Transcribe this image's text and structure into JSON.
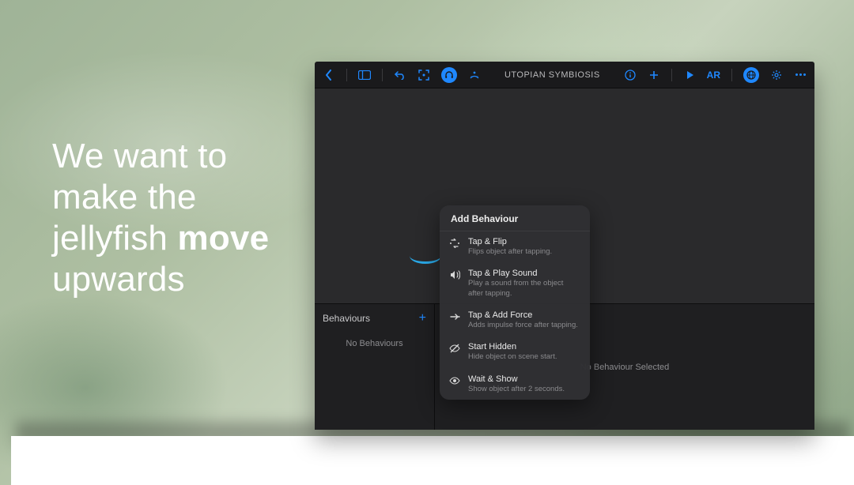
{
  "caption": {
    "line1": "We want to",
    "line2": "make the",
    "line3a": "jellyfish ",
    "line3b": "move",
    "line4": "upwards"
  },
  "toolbar": {
    "title": "UTOPIAN SYMBIOSIS",
    "ar_label": "AR"
  },
  "panel": {
    "behaviours_label": "Behaviours",
    "no_behaviours": "No Behaviours",
    "no_selection": "No Behaviour Selected"
  },
  "popup": {
    "title": "Add Behaviour",
    "items": [
      {
        "icon": "flip-icon",
        "title": "Tap & Flip",
        "desc": "Flips object after tapping."
      },
      {
        "icon": "sound-icon",
        "title": "Tap & Play Sound",
        "desc": "Play a sound from the object after tapping."
      },
      {
        "icon": "force-icon",
        "title": "Tap & Add Force",
        "desc": "Adds impulse force after tapping."
      },
      {
        "icon": "hidden-icon",
        "title": "Start Hidden",
        "desc": "Hide object on scene start."
      },
      {
        "icon": "show-icon",
        "title": "Wait & Show",
        "desc": "Show object after 2 seconds."
      }
    ]
  }
}
